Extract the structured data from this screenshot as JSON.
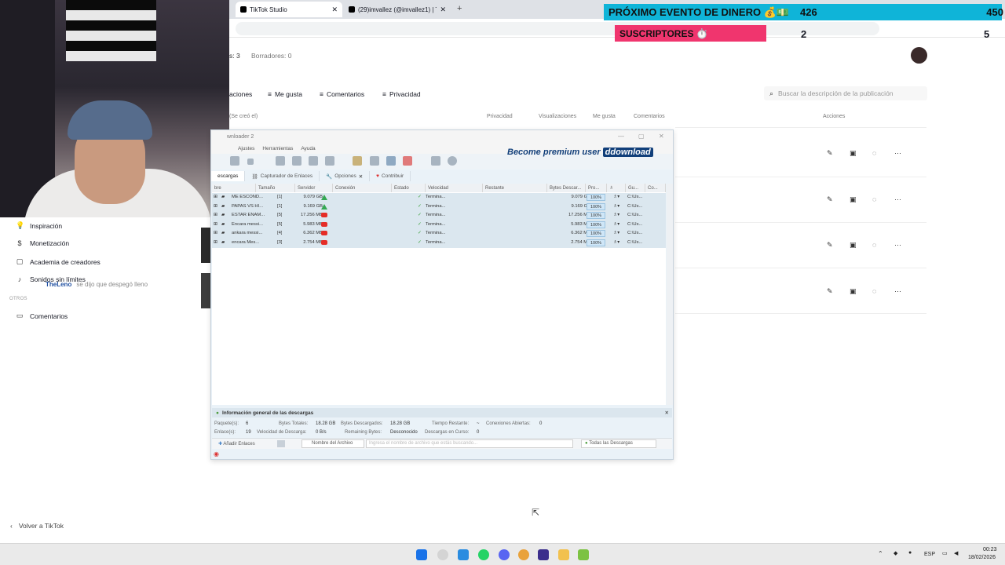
{
  "browser": {
    "tabs": [
      {
        "title": "TikTok Studio",
        "active": true
      },
      {
        "title": "(29)imvallez (@imvallez1) | TikTok",
        "active": false
      }
    ],
    "new_tab": "+",
    "close": "✕"
  },
  "overlay": {
    "event_label": "PRÓXIMO EVENTO DE DINERO 💰💵",
    "event_count": "426",
    "event_total": "450",
    "subs_label": "SUSCRIPTORES ⏱️",
    "subs_count": "2",
    "subs_total": "5",
    "chat_user": "TheLeno",
    "chat_msg": "se dijo que despegó lleno"
  },
  "sidebar": {
    "items": [
      {
        "label": "Inspiración",
        "icon": "bulb-icon"
      },
      {
        "label": "Monetización",
        "icon": "dollar-icon"
      },
      {
        "label": "Academia de creadores",
        "icon": "academy-icon"
      },
      {
        "label": "Sonidos sin límites",
        "icon": "music-icon"
      }
    ],
    "caption_otros": "OTROS",
    "comments": "Comentarios",
    "back": "Volver a TikTok"
  },
  "studio": {
    "tab_posts": "s: 3",
    "tab_drafts": "Borradores: 0",
    "filters": [
      "aciones",
      "Me gusta",
      "Comentarios",
      "Privacidad"
    ],
    "search_placeholder": "Buscar la descripción de la publicación",
    "columns": {
      "created": "(Se creó el)",
      "privacy": "Privacidad",
      "views": "Visualizaciones",
      "likes": "Me gusta",
      "comments": "Comentarios",
      "actions": "Acciones"
    },
    "more": "···"
  },
  "jdownloader": {
    "title": "wnloader 2",
    "menu": [
      "Ajustes",
      "Herramientas",
      "Ayuda"
    ],
    "premium_text": "Become premium user",
    "premium_brand": "ddownload",
    "tabs": [
      "escargas",
      "Capturador de Enlaces",
      "Opciones",
      "Contribuir"
    ],
    "columns": [
      "bre",
      "Tamaño",
      "Servidor",
      "Conexión",
      "Estado",
      "Velocidad",
      "Restante",
      "Bytes Descar...",
      "Pro...",
      "",
      "Gu...",
      "Co..."
    ],
    "rows": [
      {
        "name": "ME ESCOND...",
        "size": "9.079 GB",
        "host": "gdrive",
        "status": "Termina...",
        "bytes": "9.079 GB",
        "progress": "100%",
        "path": "C:\\Us..."
      },
      {
        "name": "PAPAS VS HI...",
        "size": "9.169 GB",
        "host": "gdrive",
        "status": "Termina...",
        "bytes": "9.169 GB",
        "progress": "100%",
        "path": "C:\\Us..."
      },
      {
        "name": "ESTAR ENAM...",
        "size": "17.256 MB",
        "host": "youtube",
        "status": "Termina...",
        "bytes": "17.256 MB",
        "progress": "100%",
        "path": "C:\\Us..."
      },
      {
        "name": "Encara messi...",
        "size": "5.983 MB",
        "host": "youtube",
        "status": "Termina...",
        "bytes": "5.983 MB",
        "progress": "100%",
        "path": "C:\\Us..."
      },
      {
        "name": "ankara messi...",
        "size": "6.362 MB",
        "host": "youtube",
        "status": "Termina...",
        "bytes": "6.362 MB",
        "progress": "100%",
        "path": "C:\\Us..."
      },
      {
        "name": "encara Mes...",
        "size": "2.754 MB",
        "host": "youtube",
        "status": "Termina...",
        "bytes": "2.754 MB",
        "progress": "100%",
        "path": "C:\\Us..."
      }
    ],
    "row_counts": [
      "[1]",
      "[1]",
      "[5]",
      "[5]",
      "[4]",
      "[3]"
    ],
    "info_title": "Información general de las descargas",
    "stats": {
      "packages_label": "Paquete(s):",
      "packages": "6",
      "total_label": "Bytes Totales:",
      "total": "18.28 GB",
      "downloaded_label": "Bytes Descargados:",
      "downloaded": "18.28 GB",
      "remaining_time_label": "Tiempo Restante:",
      "remaining_time": "~",
      "open_conn_label": "Conexiones Abiertas:",
      "open_conn": "0",
      "links_label": "Enlace(s):",
      "links": "19",
      "speed_label": "Velocidad de Descarga:",
      "speed": "0 B/s",
      "remaining_bytes_label": "Remaining Bytes:",
      "remaining_bytes": "Desconocido",
      "running_label": "Descargas en Curso:",
      "running": "0"
    },
    "bottom": {
      "add_links": "Añadir Enlaces",
      "filename": "Nombre del Archivo",
      "search_placeholder": "Ingresa el nombre de archivo que estás buscando...",
      "all_downloads": "Todas las Descargas"
    }
  },
  "taskbar": {
    "lang": "ESP",
    "time": "00:23",
    "date": "18/02/2026"
  }
}
